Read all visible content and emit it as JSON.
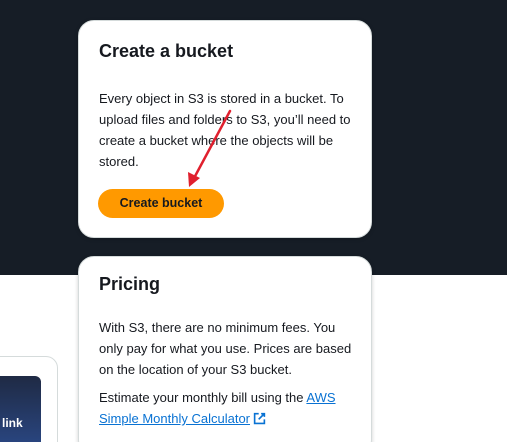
{
  "create_bucket_card": {
    "title": "Create a bucket",
    "description": "Every object in S3 is stored in a bucket. To upload files and folders to S3, you’ll need to create a bucket where the objects will be stored.",
    "button_label": "Create bucket"
  },
  "pricing_card": {
    "title": "Pricing",
    "description": "With S3, there are no minimum fees. You only pay for what you use. Prices are based on the location of your S3 bucket.",
    "estimate_prefix": "Estimate your monthly bill using the ",
    "estimate_link": "AWS Simple Monthly Calculator"
  },
  "side_tile": {
    "label": "link"
  },
  "colors": {
    "header_band": "#161d26",
    "button": "#ff9900",
    "link": "#0972d3",
    "annotation_arrow": "#e0202e"
  },
  "icons": {
    "external_link": "external-link-icon",
    "annotation": "red-arrow-icon"
  }
}
